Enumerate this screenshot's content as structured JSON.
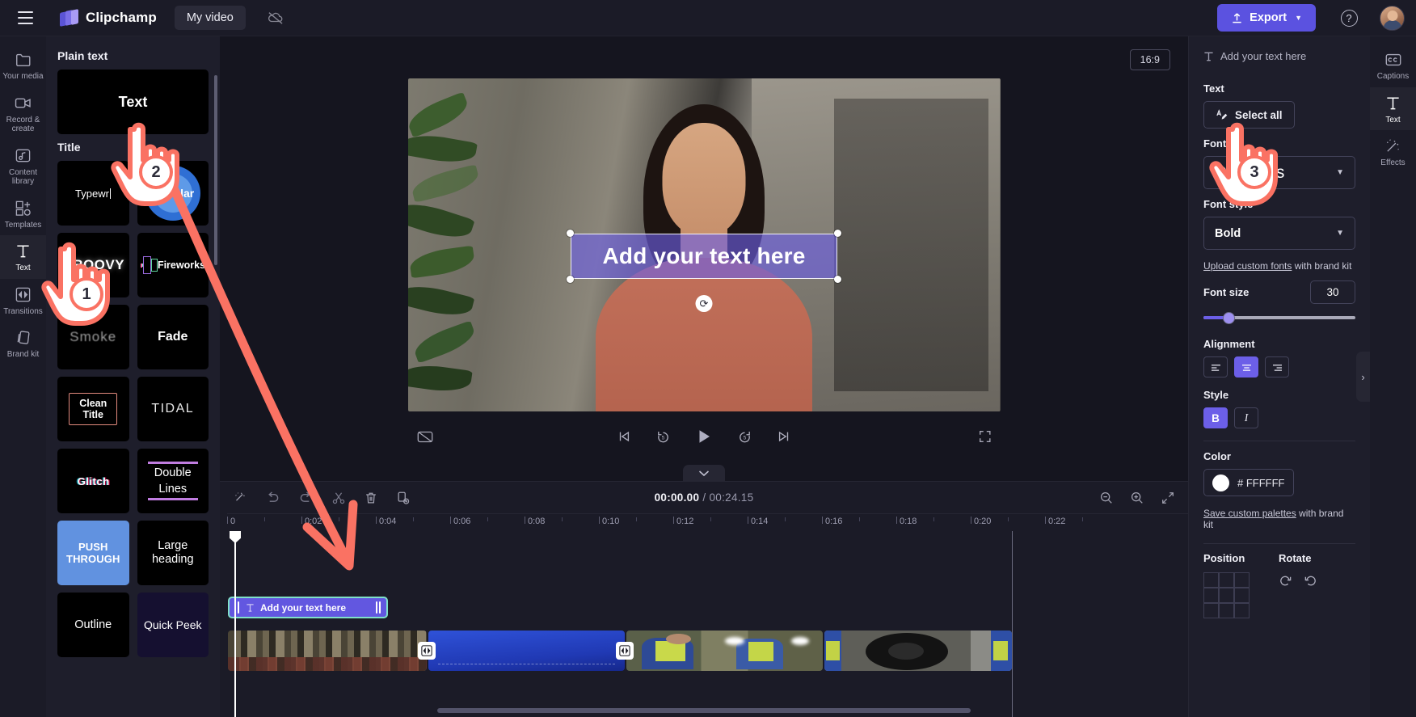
{
  "app": {
    "brand": "Clipchamp",
    "project_name": "My video",
    "export_label": "Export",
    "help_label": "?"
  },
  "left_rail": [
    {
      "label": "Your media",
      "icon": "folder-icon",
      "active": false
    },
    {
      "label": "Record &\ncreate",
      "icon": "camera-icon",
      "active": false
    },
    {
      "label": "Content\nlibrary",
      "icon": "library-icon",
      "active": false
    },
    {
      "label": "Templates",
      "icon": "templates-icon",
      "active": false
    },
    {
      "label": "Text",
      "icon": "text-icon",
      "active": true
    },
    {
      "label": "Transitions",
      "icon": "transitions-icon",
      "active": false
    },
    {
      "label": "Brand kit",
      "icon": "brandkit-icon",
      "active": false
    }
  ],
  "library": {
    "section_plain": "Plain text",
    "plain_item": "Text",
    "section_title": "Title",
    "titles": [
      "Typewr",
      "Circular",
      "GROOVY",
      "Fireworks",
      "Smoke",
      "Fade",
      "Clean Title",
      "TIDAL",
      "Glitch",
      "Double Lines",
      "PUSH THROUGH",
      "Large heading",
      "Outline",
      "Quick Peek"
    ],
    "clean_title_line1": "Clean",
    "clean_title_line2": "Title",
    "double_line1": "Double",
    "double_line2": "Lines",
    "large_line1": "Large",
    "large_line2": "heading"
  },
  "preview": {
    "aspect_ratio": "16:9",
    "overlay_text": "Add your text here",
    "captions_icon": "captions-off-icon",
    "fullscreen_icon": "fullscreen-icon"
  },
  "timeline": {
    "current_time": "00:00.00",
    "separator": "/",
    "total_time": "00:24.15",
    "toolbar_icons": [
      "magic-wand-icon",
      "undo-icon",
      "redo-icon",
      "split-icon",
      "delete-icon",
      "duplicate-icon"
    ],
    "zoom_out_icon": "zoom-out-icon",
    "zoom_in_icon": "zoom-in-icon",
    "fit-icon": "fit-to-screen-icon",
    "ruler_labels": [
      "0",
      "0:02",
      "0:04",
      "0:06",
      "0:08",
      "0:10",
      "0:12",
      "0:14",
      "0:16",
      "0:18",
      "0:20",
      "0:22"
    ],
    "text_clip_label": "Add your text here",
    "transition_icon": "transition-icon"
  },
  "properties": {
    "header": "Add your text here",
    "text_label": "Text",
    "select_all": "Select all",
    "font_label": "Font",
    "font_value": "DM Sans",
    "font_style_label": "Font style",
    "font_style_value": "Bold",
    "upload_link": "Upload custom fonts",
    "upload_suffix": " with brand kit",
    "font_size_label": "Font size",
    "font_size_value": "30",
    "alignment_label": "Alignment",
    "style_label": "Style",
    "bold_label": "B",
    "italic_label": "I",
    "color_label": "Color",
    "color_hex": "# FFFFFF",
    "save_palettes_link": "Save custom palettes",
    "save_palettes_suffix": " with brand kit",
    "position_label": "Position",
    "rotate_label": "Rotate"
  },
  "right_rail": [
    {
      "label": "Captions",
      "icon": "captions-icon",
      "active": false
    },
    {
      "label": "Text",
      "icon": "text-icon",
      "active": true
    },
    {
      "label": "Effects",
      "icon": "effects-icon",
      "active": false
    }
  ],
  "annotations": {
    "step1": "1",
    "step2": "2",
    "step3": "3",
    "accent": "#fa7263"
  },
  "colors": {
    "accent_purple": "#6c5fe8",
    "export_bg": "#5b52e0",
    "clip_selected_border": "#7fe0c8",
    "panel_bg": "#1e1e2b",
    "rail_bg": "#1b1b27"
  }
}
